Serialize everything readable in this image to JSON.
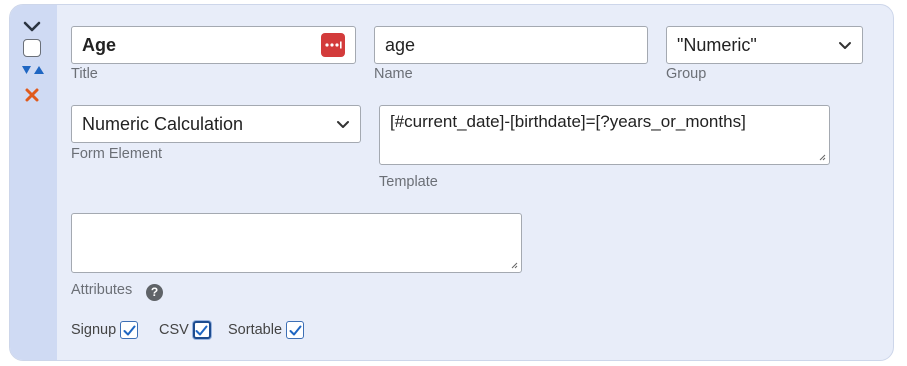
{
  "title_field": {
    "label": "Title",
    "value": "Age"
  },
  "name_field": {
    "label": "Name",
    "value": "age"
  },
  "group_field": {
    "label": "Group",
    "value": "\"Numeric\""
  },
  "form_element_field": {
    "label": "Form Element",
    "value": "Numeric Calculation"
  },
  "template_field": {
    "label": "Template",
    "value": "[#current_date]-[birthdate]=[?years_or_months]"
  },
  "attributes_field": {
    "label": "Attributes",
    "value": "",
    "help": "?"
  },
  "checkboxes": {
    "signup": {
      "label": "Signup",
      "checked": true
    },
    "csv": {
      "label": "CSV",
      "checked": true
    },
    "sortable": {
      "label": "Sortable",
      "checked": true
    }
  },
  "colors": {
    "accent": "#1f66c2",
    "danger": "#d33b3b",
    "delete": "#e05a1c"
  }
}
